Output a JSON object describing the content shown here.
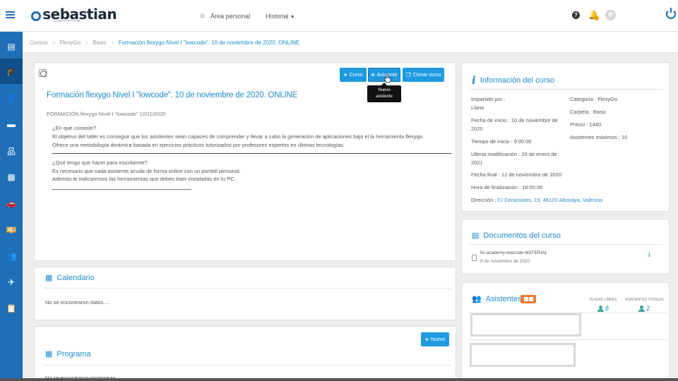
{
  "header": {
    "brand": "sebastian",
    "brand_sub": "Employee Portal",
    "nav": {
      "area_personal": "Área personal",
      "historial": "Historial"
    },
    "help_label": "?"
  },
  "sidebar": {
    "items": [
      {
        "icon": "document-icon",
        "glyph": "▤"
      },
      {
        "icon": "graduation-cap-icon",
        "glyph": "🎓",
        "active": true
      },
      {
        "icon": "user-icon",
        "glyph": "👤"
      },
      {
        "icon": "folder-icon",
        "glyph": "▬"
      },
      {
        "icon": "org-chart-icon",
        "glyph": "品"
      },
      {
        "icon": "calendar-icon",
        "glyph": "▦"
      },
      {
        "icon": "car-icon",
        "glyph": "🚗"
      },
      {
        "icon": "money-icon",
        "glyph": "💴"
      },
      {
        "icon": "team-icon",
        "glyph": "👥"
      },
      {
        "icon": "plane-icon",
        "glyph": "✈"
      },
      {
        "icon": "checklist-icon",
        "glyph": "📋"
      }
    ]
  },
  "breadcrumb": [
    "Cursos",
    "FlexyGo",
    "Basic",
    "Formación flexygo Nivel I \"lowcode\". 10 de noviembre de 2020. ONLINE"
  ],
  "course": {
    "buttons": {
      "curso": "Curso",
      "asistente": "Asistente",
      "clonar": "Clonar curso"
    },
    "tooltip_line1": "Nuevo",
    "tooltip_line2": "asistente",
    "title": "Formación flexygo Nivel I \"lowcode\". 10 de noviembre de 2020. ONLINE",
    "subtitle": "FORMACIÓN flexygo Nivel I \"lowcode\" 10/11/2020",
    "q1": "¿En qué consiste?",
    "q1_line1": "El objetivo del taller es conseguir que los asistentes sean capaces de comprender y llevar a cabo la generación de aplicaciones bajo el la herramienta flexygo.",
    "q1_line2": "Ofrece una metodología dinámica basada en ejercicios prácticos tutorizados por profesores expertos en últimas tecnologías.",
    "q2": "¿Qué tengo que hacer para inscribirme?",
    "q2_line1": "Es necesario que cada asistente acuda de forma online con un portátil personal.",
    "q2_line2": "Además te indicaremos las herramientas que debes traer instaladas en tu PC."
  },
  "calendario": {
    "title": "Calendario",
    "empty": "No se encontraron datos...."
  },
  "programa": {
    "title": "Programa",
    "nuevo": "Nuevo",
    "empty": "No se encontraron programas"
  },
  "info": {
    "title": "Información del curso",
    "impartido_label": "Impartido por :",
    "impartido_value": "Llano",
    "fecha_inicio_line1": "Fecha de inicio : 10 de noviembre de",
    "fecha_inicio_line2": "2020",
    "tiempo_inicio": "Tiempo de inicio : 9:00:00",
    "ultima_mod_line1": "Ultima modificación : 20 de enero de",
    "ultima_mod_line2": "2021",
    "fecha_final": "Fecha final : 12 de noviembre de 2020",
    "hora_fin": "Hora de finalización : 18:00:00",
    "direccion_label": "Dirección :",
    "direccion_value": "C/ Ceramistes, 19, 46120 Alboraya, Valencia",
    "categoria": "Categoría : FlexyGo",
    "carpeta": "Carpeta : Basic",
    "precio": "Precio : 1440",
    "asistentes_max": "Asistentes máximos : 10"
  },
  "documentos": {
    "title": "Documentos del curso",
    "file_name": "flx-academy-lowcode-MATERIAL",
    "file_date": "9 de noviembre de 2020"
  },
  "asistentes": {
    "title": "Asistentes",
    "plazas_label": "PLAZAS LIBRES",
    "plazas_value": "8",
    "totales_label": "ASISTENTES TOTALES",
    "totales_value": "2"
  }
}
